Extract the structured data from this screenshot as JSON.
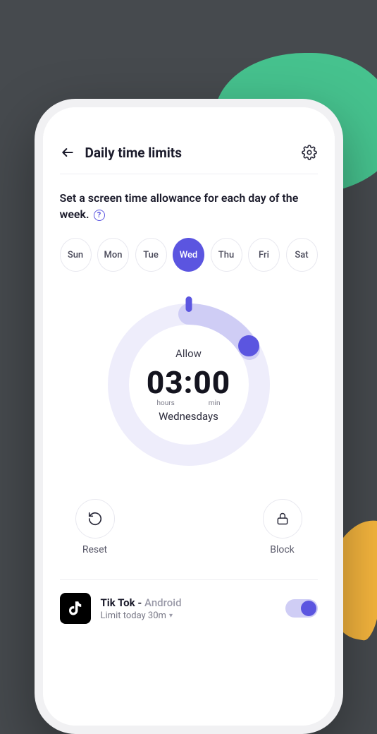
{
  "header": {
    "title": "Daily time limits"
  },
  "description": "Set a screen time allowance for each day of the week.",
  "days": [
    {
      "short": "Sun",
      "active": false
    },
    {
      "short": "Mon",
      "active": false
    },
    {
      "short": "Tue",
      "active": false
    },
    {
      "short": "Wed",
      "active": true
    },
    {
      "short": "Thu",
      "active": false
    },
    {
      "short": "Fri",
      "active": false
    },
    {
      "short": "Sat",
      "active": false
    }
  ],
  "dial": {
    "allow_label": "Allow",
    "time": "03:00",
    "hours_unit": "hours",
    "min_unit": "min",
    "day_name": "Wednesdays"
  },
  "actions": {
    "reset_label": "Reset",
    "block_label": "Block"
  },
  "app": {
    "name": "Tik Tok",
    "separator": " - ",
    "platform": "Android",
    "limit": "Limit today 30m",
    "toggle_on": true
  },
  "colors": {
    "accent": "#5b55e0",
    "green_blob": "#46c28e",
    "yellow_blob": "#f6b63e"
  }
}
